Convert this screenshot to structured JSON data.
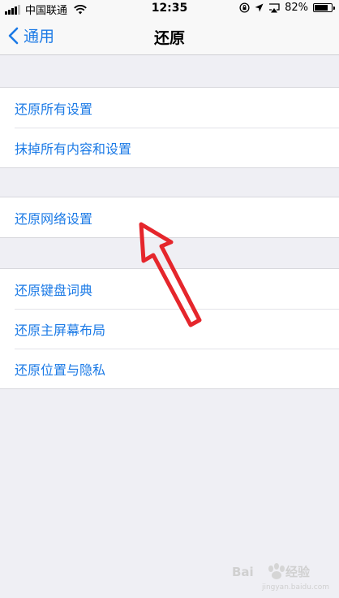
{
  "status_bar": {
    "carrier": "中国联通",
    "time": "12:35",
    "battery_percent": "82%",
    "battery_level": 0.82
  },
  "nav": {
    "back_label": "通用",
    "title": "还原"
  },
  "groups": [
    {
      "items": [
        "还原所有设置",
        "抹掉所有内容和设置"
      ]
    },
    {
      "items": [
        "还原网络设置"
      ]
    },
    {
      "items": [
        "还原键盘词典",
        "还原主屏幕布局",
        "还原位置与隐私"
      ]
    }
  ],
  "annotation": {
    "arrow_color": "#e5262c"
  },
  "watermark": {
    "brand": "Baidu经验",
    "url": "jingyan.baidu.com"
  }
}
